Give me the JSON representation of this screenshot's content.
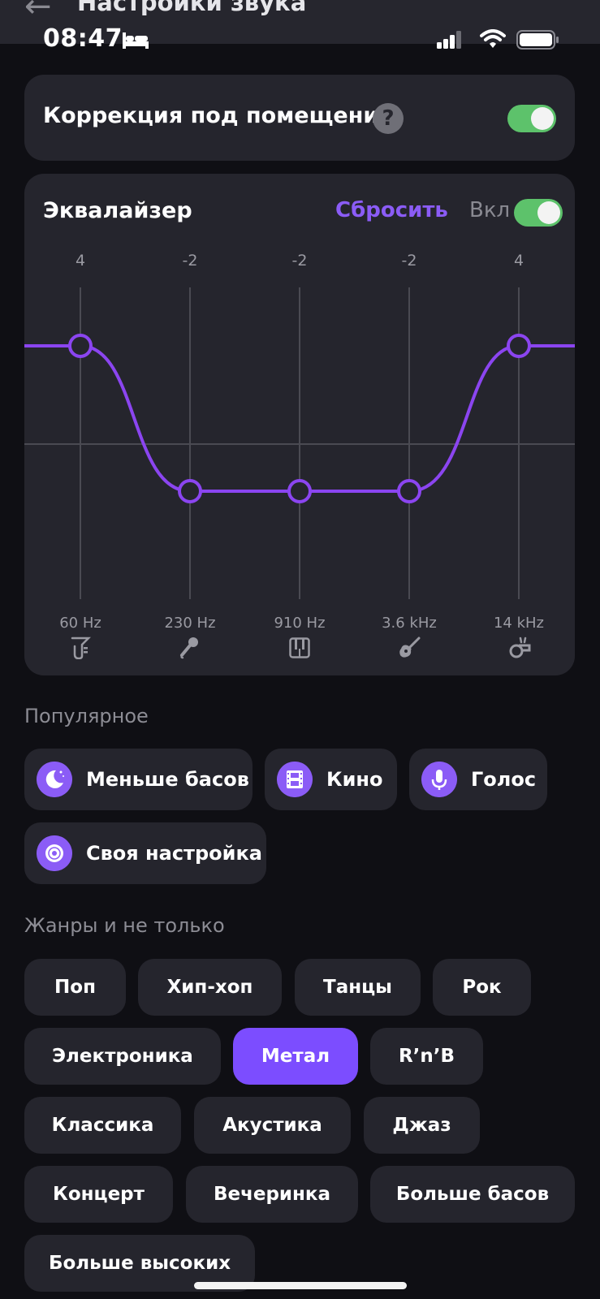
{
  "header": {
    "title": "Настройки звука"
  },
  "status_bar": {
    "time": "08:47"
  },
  "room_correction": {
    "label": "Коррекция под помещение",
    "enabled": true
  },
  "equalizer": {
    "title": "Эквалайзер",
    "reset_label": "Сбросить",
    "on_label": "Вкл",
    "enabled": true,
    "bands": [
      {
        "gain": "4",
        "freq": "60 Hz",
        "icon": "tuba-icon"
      },
      {
        "gain": "-2",
        "freq": "230 Hz",
        "icon": "microphone-icon"
      },
      {
        "gain": "-2",
        "freq": "910 Hz",
        "icon": "piano-keys-icon"
      },
      {
        "gain": "-2",
        "freq": "3.6 kHz",
        "icon": "guitar-icon"
      },
      {
        "gain": "4",
        "freq": "14 kHz",
        "icon": "whistle-icon"
      }
    ]
  },
  "popular": {
    "title": "Популярное",
    "items": [
      {
        "label": "Меньше басов",
        "icon": "moon-icon"
      },
      {
        "label": "Кино",
        "icon": "film-icon"
      },
      {
        "label": "Голос",
        "icon": "microphone-icon"
      },
      {
        "label": "Своя настройка",
        "icon": "vinyl-icon"
      }
    ]
  },
  "genres": {
    "title": "Жанры и не только",
    "selected": "Метал",
    "items": [
      "Поп",
      "Хип-хоп",
      "Танцы",
      "Рок",
      "Электроника",
      "Метал",
      "R’n’B",
      "Классика",
      "Акустика",
      "Джаз",
      "Концерт",
      "Вечеринка",
      "Больше басов",
      "Больше высоких"
    ]
  },
  "colors": {
    "accent": "#8b5cf6",
    "selected_chip": "#7c4dff",
    "toggle_on": "#5dc26b",
    "card": "#25252d",
    "background": "#0f0f14"
  }
}
